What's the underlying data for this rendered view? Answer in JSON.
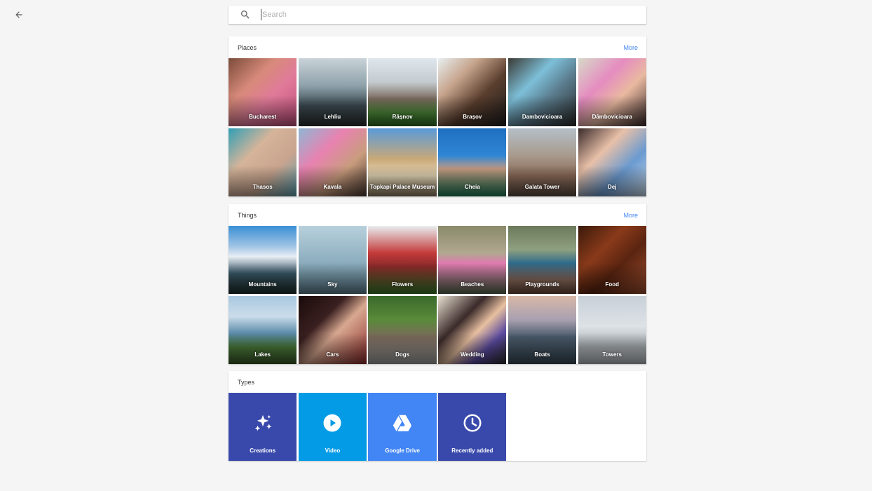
{
  "search": {
    "placeholder": "Search",
    "value": ""
  },
  "places": {
    "title": "Places",
    "more_label": "More",
    "items": [
      {
        "label": "Bucharest",
        "bg": "linear-gradient(135deg,#7a4b3a 0%,#d88a7a 35%,#e07a9a 60%,#c24f7a 100%)"
      },
      {
        "label": "Lehliu",
        "bg": "linear-gradient(180deg,#c9d3d8 0%,#8fa2ab 40%,#3c4b52 70%,#2b2f30 100%)"
      },
      {
        "label": "Râșnov",
        "bg": "linear-gradient(180deg,#dfe7ee 0%,#c4cbcf 35%,#7a6a5e 60%,#4f8a3a 80%,#2f6d24 100%)"
      },
      {
        "label": "Brașov",
        "bg": "linear-gradient(135deg,#e8eef0 0%,#c6a48c 30%,#5a3e2e 60%,#1d1d1d 100%)"
      },
      {
        "label": "Dambovicioara",
        "bg": "linear-gradient(135deg,#3a3a35 0%,#7dbfd8 35%,#5a7b8c 60%,#2a2a2a 100%)"
      },
      {
        "label": "Dâmbovicioara",
        "bg": "linear-gradient(135deg,#d7d9c8 0%,#e58cc0 35%,#e9b9a0 60%,#3a2a2a 100%)"
      },
      {
        "label": "Thasos",
        "bg": "linear-gradient(135deg,#2f9fb5 0%,#d5b49a 35%,#c8a48e 65%,#5aa0b0 100%)"
      },
      {
        "label": "Kavala",
        "bg": "linear-gradient(135deg,#8fb6d4 0%,#e882b0 35%,#c99c7e 65%,#4a3a30 100%)"
      },
      {
        "label": "Topkapi Palace Museum",
        "bg": "linear-gradient(180deg,#5a9ad8 0%,#c9a978 45%,#e6d8b8 70%,#8a7a60 100%)"
      },
      {
        "label": "Cheia",
        "bg": "linear-gradient(180deg,#1f6fc0 0%,#2f86d4 40%,#c49a80 60%,#1f7d5a 100%)"
      },
      {
        "label": "Galata Tower",
        "bg": "linear-gradient(180deg,#b4bfc8 0%,#a89a8c 40%,#8a6a58 70%,#5a4a40 100%)"
      },
      {
        "label": "Dej",
        "bg": "linear-gradient(135deg,#3a2a2a 0%,#e8c0a8 35%,#6a9ad0 65%,#c8d8e8 100%)"
      }
    ]
  },
  "things": {
    "title": "Things",
    "more_label": "More",
    "items": [
      {
        "label": "Mountains",
        "bg": "linear-gradient(180deg,#3a8fd6 0%,#9fc4e4 30%,#e8eef4 45%,#3a5a6a 70%,#1e2e2a 100%)"
      },
      {
        "label": "Sky",
        "bg": "linear-gradient(180deg,#b8d0dc 0%,#8fb0c0 50%,#5d8090 100%)"
      },
      {
        "label": "Flowers",
        "bg": "linear-gradient(180deg,#e8eef0 0%,#c43a3a 40%,#8a2a2a 60%,#3a7a2a 100%)"
      },
      {
        "label": "Beaches",
        "bg": "linear-gradient(180deg,#8a8a6a 0%,#b0a890 40%,#e07ab0 55%,#5a6a50 100%)"
      },
      {
        "label": "Playgrounds",
        "bg": "linear-gradient(180deg,#6a7a5a 0%,#8fa080 35%,#2f6a8a 55%,#8a6a5a 80%,#6a4a3a 100%)"
      },
      {
        "label": "Food",
        "bg": "linear-gradient(135deg,#3a1a0a 0%,#8a3a1a 35%,#5a2410 60%,#a05030 100%)"
      },
      {
        "label": "Lakes",
        "bg": "linear-gradient(180deg,#a8c8e0 0%,#cbdcea 30%,#5a8aa8 55%,#4a7a3a 75%,#3a5a2a 100%)"
      },
      {
        "label": "Cars",
        "bg": "linear-gradient(135deg,#1a0a0a 0%,#3a2020 35%,#d8a890 55%,#8a2a2a 100%)"
      },
      {
        "label": "Dogs",
        "bg": "linear-gradient(180deg,#3a6a2a 0%,#5a8a3a 35%,#7a6a5a 60%,#a0a0a0 100%)"
      },
      {
        "label": "Wedding",
        "bg": "linear-gradient(135deg,#e8e0d0 0%,#3a2a2a 35%,#e8c0a0 55%,#5a4aa0 75%,#2a2a2a 100%)"
      },
      {
        "label": "Boats",
        "bg": "linear-gradient(180deg,#d8b8a8 0%,#a8a0b0 35%,#4a5a6a 60%,#3a4a58 100%)"
      },
      {
        "label": "Towers",
        "bg": "linear-gradient(180deg,#c8d0d8 0%,#dde2e6 45%,#a8aeb2 75%,#b8bec2 100%)"
      }
    ]
  },
  "types": {
    "title": "Types",
    "items": [
      {
        "label": "Creations",
        "icon": "creations-sparkle-icon",
        "color": "#3949ab"
      },
      {
        "label": "Video",
        "icon": "play-circle-icon",
        "color": "#039be5"
      },
      {
        "label": "Google Drive",
        "icon": "google-drive-icon",
        "color": "#4285f4"
      },
      {
        "label": "Recently added",
        "icon": "clock-icon",
        "color": "#3949ab"
      }
    ]
  }
}
